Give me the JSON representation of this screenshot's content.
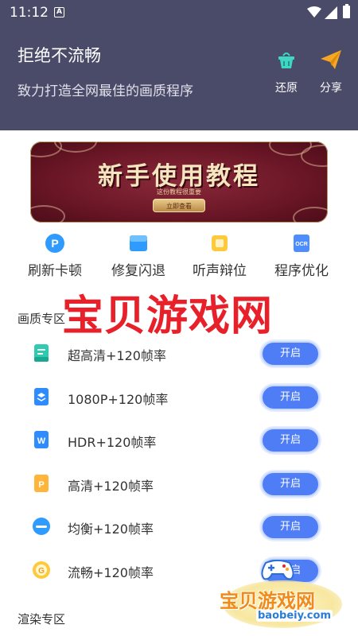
{
  "status_bar": {
    "time": "11:12",
    "notification_icon": "A"
  },
  "header": {
    "title": "拒绝不流畅",
    "subtitle": "致力打造全网最佳的画质程序",
    "restore_label": "还原",
    "share_label": "分享",
    "color": "#4a4a69"
  },
  "banner": {
    "headline": "新手使用教程",
    "tagline": "这份教程很重要",
    "button_label": "立即查看"
  },
  "quick_actions": [
    {
      "label": "刷新卡顿",
      "icon": "refresh-p-icon"
    },
    {
      "label": "修复闪退",
      "icon": "repair-icon"
    },
    {
      "label": "听声辩位",
      "icon": "sound-icon"
    },
    {
      "label": "程序优化",
      "icon": "ocr-optimize-icon"
    }
  ],
  "watermark": "宝贝游戏网",
  "quality_section": {
    "title": "画质专区",
    "button_label": "开启",
    "items": [
      {
        "label": "超高清+120帧率",
        "icon": "doc-teal-icon"
      },
      {
        "label": "1080P+120帧率",
        "icon": "layers-icon"
      },
      {
        "label": "HDR+120帧率",
        "icon": "word-doc-icon"
      },
      {
        "label": "高清+120帧率",
        "icon": "ppt-doc-icon"
      },
      {
        "label": "均衡+120帧率",
        "icon": "cloud-icon"
      },
      {
        "label": "流畅+120帧率",
        "icon": "g-coin-icon"
      }
    ]
  },
  "render_section": {
    "title": "渲染专区"
  },
  "logo": {
    "name": "宝贝游戏网",
    "url": "baobeiy.com"
  },
  "colors": {
    "accent": "#4e7df5",
    "watermark": "#e8202a"
  }
}
